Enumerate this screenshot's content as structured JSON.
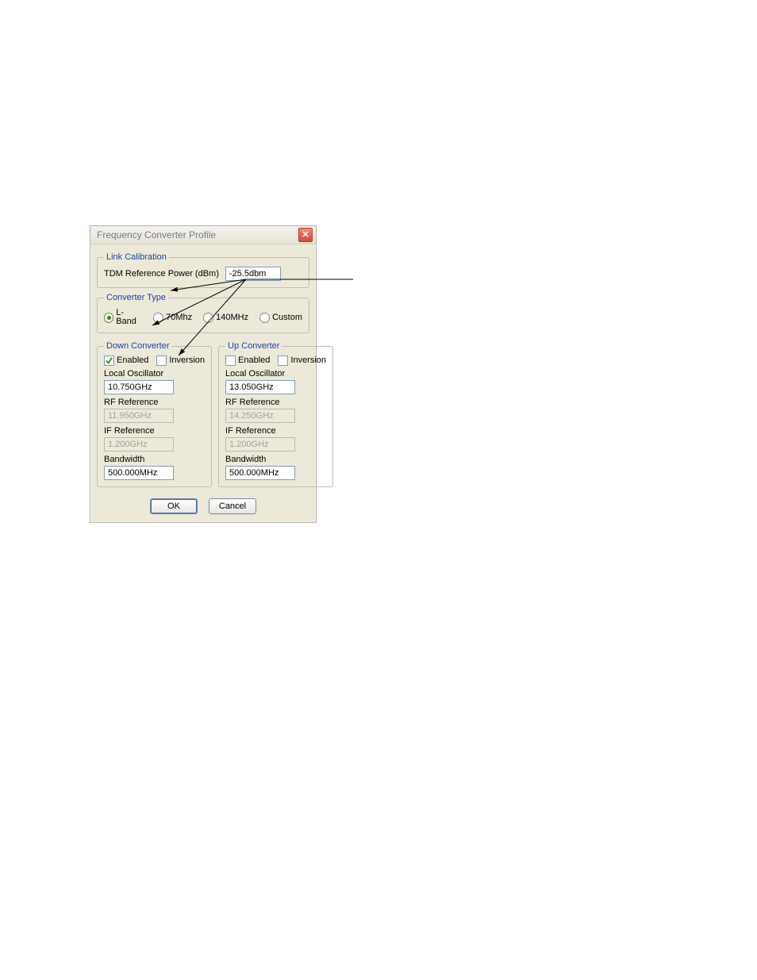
{
  "dialog": {
    "title": "Frequency Converter Profile"
  },
  "link_calibration": {
    "legend": "Link Calibration",
    "tdm_label": "TDM Reference Power (dBm)",
    "tdm_value": "-25.5dbm"
  },
  "converter_type": {
    "legend": "Converter Type",
    "options": {
      "lband": "L-Band",
      "m70": "70Mhz",
      "m140": "140MHz",
      "custom": "Custom"
    },
    "selected": "lband"
  },
  "down_converter": {
    "legend": "Down Converter",
    "enabled_label": "Enabled",
    "enabled": true,
    "inversion_label": "Inversion",
    "inversion": false,
    "local_oscillator_label": "Local Oscillator",
    "local_oscillator": "10.750GHz",
    "rf_reference_label": "RF Reference",
    "rf_reference": "11.950GHz",
    "if_reference_label": "IF Reference",
    "if_reference": "1.200GHz",
    "bandwidth_label": "Bandwidth",
    "bandwidth": "500.000MHz"
  },
  "up_converter": {
    "legend": "Up Converter",
    "enabled_label": "Enabled",
    "enabled": false,
    "inversion_label": "Inversion",
    "inversion": false,
    "local_oscillator_label": "Local Oscillator",
    "local_oscillator": "13.050GHz",
    "rf_reference_label": "RF Reference",
    "rf_reference": "14.250GHz",
    "if_reference_label": "IF Reference",
    "if_reference": "1.200GHz",
    "bandwidth_label": "Bandwidth",
    "bandwidth": "500.000MHz"
  },
  "buttons": {
    "ok": "OK",
    "cancel": "Cancel"
  }
}
